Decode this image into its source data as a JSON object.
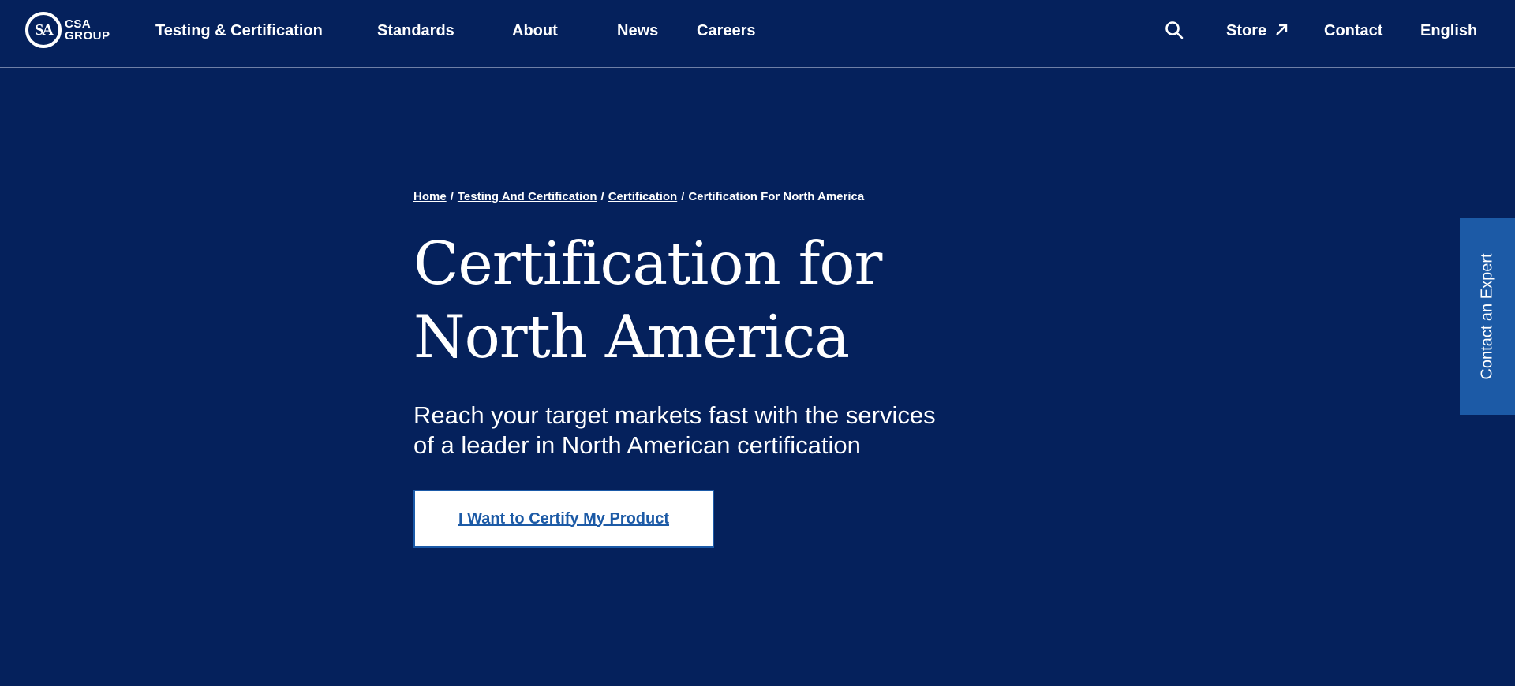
{
  "colors": {
    "background": "#05215c",
    "accent": "#1c5aa6",
    "text": "#ffffff"
  },
  "logo": {
    "mark": "SA",
    "line1": "CSA",
    "line2": "GROUP"
  },
  "nav": {
    "items": [
      {
        "label": "Testing & Certification"
      },
      {
        "label": "Standards"
      },
      {
        "label": "About"
      },
      {
        "label": "News"
      },
      {
        "label": "Careers"
      }
    ],
    "search_icon": "search-icon",
    "store": {
      "label": "Store",
      "icon": "external-arrow-icon"
    },
    "contact": "Contact",
    "language": "English"
  },
  "breadcrumb": {
    "items": [
      "Home",
      "Testing And Certification",
      "Certification"
    ],
    "separator": "/",
    "current": "Certification For North America"
  },
  "hero": {
    "title_line1": "Certification for",
    "title_line2": "North America",
    "subtitle_line1": "Reach your target markets fast with the services",
    "subtitle_line2": "of a leader in North American certification",
    "cta_label": "I Want to Certify My Product"
  },
  "side_tab": {
    "label": "Contact an Expert"
  }
}
